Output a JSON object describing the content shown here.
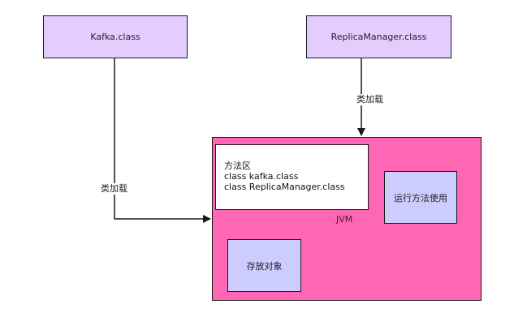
{
  "nodes": {
    "kafka_class": {
      "label": "Kafka.class"
    },
    "replica_class": {
      "label": "ReplicaManager.class"
    },
    "jvm": {
      "label": "JVM"
    },
    "method_area": {
      "lines": [
        "方法区",
        "class kafka.class",
        "class ReplicaManager.class"
      ]
    },
    "run_method": {
      "label": "运行方法使用"
    },
    "store_object": {
      "label": "存放对象"
    }
  },
  "edges": {
    "kafka_to_jvm": {
      "label": "类加载"
    },
    "replica_to_jvm": {
      "label": "类加载"
    }
  },
  "colors": {
    "class_box_fill": "#e4ccff",
    "jvm_fill": "#ff66b3",
    "inner_box_fill": "#ccccff",
    "method_area_fill": "#ffffff",
    "line": "#1a1a1a"
  }
}
